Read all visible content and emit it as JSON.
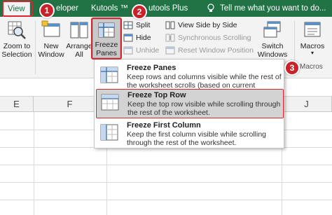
{
  "tabs": {
    "view": "View",
    "developer": "eloper",
    "kutools": "Kutools ™",
    "kutools_plus": "utools Plus",
    "tell_me": "Tell me what you want to do..."
  },
  "ribbon": {
    "zoom_to_selection": [
      "Zoom to",
      "Selection"
    ],
    "new_window": [
      "New",
      "Window"
    ],
    "arrange_all": [
      "Arrange",
      "All"
    ],
    "freeze_panes": [
      "Freeze",
      "Panes"
    ],
    "split": "Split",
    "hide": "Hide",
    "unhide": "Unhide",
    "view_side_by_side": "View Side by Side",
    "synchronous_scrolling": "Synchronous Scrolling",
    "reset_window_position": "Reset Window Position",
    "switch_windows": [
      "Switch",
      "Windows"
    ],
    "macros": "Macros",
    "macros_group": "Macros"
  },
  "columns": [
    "E",
    "F",
    "J"
  ],
  "menu": {
    "items": [
      {
        "title": "Freeze Panes",
        "description": "Keep rows and columns visible while the rest of the worksheet scrolls (based on current selection)."
      },
      {
        "title": "Freeze Top Row",
        "description": "Keep the top row visible while scrolling through the rest of the worksheet."
      },
      {
        "title": "Freeze First Column",
        "description": "Keep the first column visible while scrolling through the rest of the worksheet."
      }
    ]
  },
  "callouts": [
    "1",
    "2",
    "3"
  ],
  "colors": {
    "excel_green": "#217346",
    "callout_red": "#d9262c",
    "highlight_gray": "#d3d3d3"
  }
}
